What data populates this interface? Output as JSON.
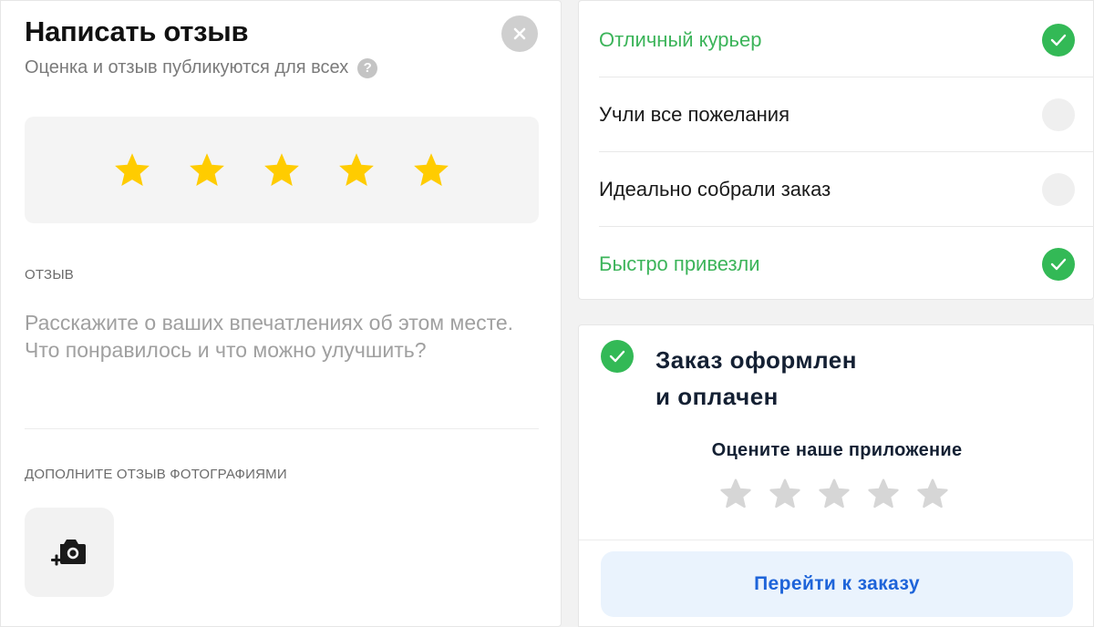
{
  "review": {
    "title": "Написать отзыв",
    "subtitle": "Оценка и отзыв публикуются для всех",
    "help_glyph": "?",
    "rating": 5,
    "rating_max": 5,
    "review_label": "ОТЗЫВ",
    "review_placeholder": "Расскажите о ваших впечатлениях об этом месте. Что понравилось и что можно улучшить?",
    "photos_label": "ДОПОЛНИТЕ ОТЗЫВ ФОТОГРАФИЯМИ",
    "icons": {
      "close": "close-icon",
      "help": "help-icon",
      "star": "star-icon",
      "add_photo": "add-photo-icon"
    }
  },
  "feedback": {
    "items": [
      {
        "label": "Отличный курьер",
        "checked": true
      },
      {
        "label": "Учли все пожелания",
        "checked": false
      },
      {
        "label": "Идеально собрали заказ",
        "checked": false
      },
      {
        "label": "Быстро привезли",
        "checked": true
      }
    ]
  },
  "order": {
    "title_line1": "Заказ оформлен",
    "title_line2": "и оплачен",
    "rate_app": "Оцените наше приложение",
    "app_rating": 0,
    "app_rating_max": 5,
    "goto_button": "Перейти к заказу"
  },
  "colors": {
    "star_filled": "#FFCC00",
    "star_empty": "#D6D6D6",
    "check_green": "#33B956",
    "active_text": "#3CB45A",
    "link_blue": "#1E64D9"
  }
}
